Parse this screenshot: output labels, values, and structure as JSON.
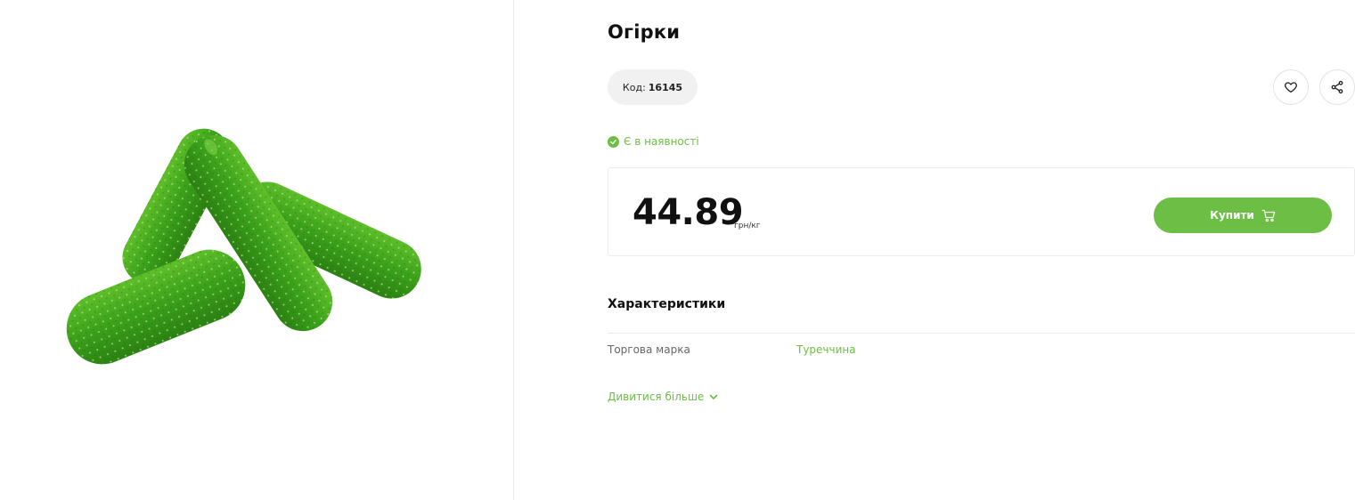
{
  "product": {
    "title": "Огірки",
    "code_label": "Код:",
    "code_value": "16145",
    "availability": "Є в наявності",
    "price": "44.89",
    "unit": "грн/кг",
    "buy_label": "Купити"
  },
  "specs": {
    "heading": "Характеристики",
    "rows": [
      {
        "label": "Торгова марка",
        "value": "Туреччина"
      }
    ],
    "more_label": "Дивитися більше"
  },
  "icons": {
    "favorite": "heart-icon",
    "share": "share-icon",
    "stock": "check-circle-icon",
    "cart": "cart-icon",
    "more": "chevron-down-icon"
  },
  "colors": {
    "accent": "#6cbf44",
    "text": "#111111",
    "muted": "#666666",
    "pill_bg": "#f1f1f1",
    "border": "#ececec"
  }
}
